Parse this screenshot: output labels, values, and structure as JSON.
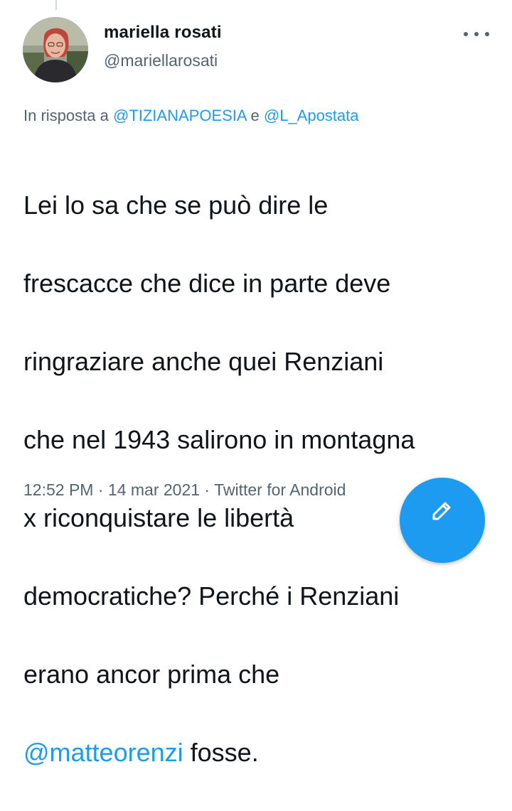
{
  "author": {
    "display_name": "mariella rosati",
    "handle": "@mariellarosati",
    "avatar_icon": "profile-photo"
  },
  "reply": {
    "prefix": "In risposta a",
    "mention1": "@TIZIANAPOESIA",
    "conjunction": "e",
    "mention2": "@L_Apostata"
  },
  "tweet": {
    "lines": [
      "Lei lo sa che se può dire le",
      "frescacce che dice in parte deve",
      "ringraziare anche quei Renziani",
      "che nel 1943 salirono in montagna",
      "x riconquistare le libertà",
      "democratiche? Perché i Renziani",
      "erano ancor prima che"
    ],
    "last_mention": "@matteorenzi",
    "last_text": " fosse."
  },
  "meta": {
    "time": "12:52 PM",
    "separator": " · ",
    "date": "14 mar 2021",
    "source": "Twitter for Android"
  },
  "colors": {
    "accent": "#1d9bf0",
    "secondary_text": "#536471",
    "primary_text": "#0f1419"
  },
  "icons": {
    "more": "more-horizontal-icon",
    "compose": "compose-tweet-icon"
  }
}
